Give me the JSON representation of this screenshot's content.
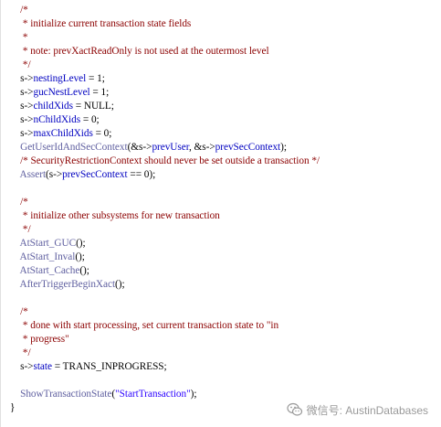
{
  "code_lines": [
    [
      {
        "t": "    /*",
        "c": "cmt"
      }
    ],
    [
      {
        "t": "     * initialize current transaction state fields",
        "c": "cmt"
      }
    ],
    [
      {
        "t": "     *",
        "c": "cmt"
      }
    ],
    [
      {
        "t": "     * note: prevXactReadOnly is not used at the outermost level",
        "c": "cmt"
      }
    ],
    [
      {
        "t": "     */",
        "c": "cmt"
      }
    ],
    [
      {
        "t": "    s->",
        "c": "pl"
      },
      {
        "t": "nestingLevel",
        "c": "fld"
      },
      {
        "t": " = 1;",
        "c": "pl"
      }
    ],
    [
      {
        "t": "    s->",
        "c": "pl"
      },
      {
        "t": "gucNestLevel",
        "c": "fld"
      },
      {
        "t": " = 1;",
        "c": "pl"
      }
    ],
    [
      {
        "t": "    s->",
        "c": "pl"
      },
      {
        "t": "childXids",
        "c": "fld"
      },
      {
        "t": " = NULL;",
        "c": "pl"
      }
    ],
    [
      {
        "t": "    s->",
        "c": "pl"
      },
      {
        "t": "nChildXids",
        "c": "fld"
      },
      {
        "t": " = 0;",
        "c": "pl"
      }
    ],
    [
      {
        "t": "    s->",
        "c": "pl"
      },
      {
        "t": "maxChildXids",
        "c": "fld"
      },
      {
        "t": " = 0;",
        "c": "pl"
      }
    ],
    [
      {
        "t": "    GetUserIdAndSecContext",
        "c": "fn"
      },
      {
        "t": "(&s->",
        "c": "pl"
      },
      {
        "t": "prevUser",
        "c": "fld"
      },
      {
        "t": ", &s->",
        "c": "pl"
      },
      {
        "t": "prevSecContext",
        "c": "fld"
      },
      {
        "t": ");",
        "c": "pl"
      }
    ],
    [
      {
        "t": "    /* SecurityRestrictionContext should never be set outside a transaction */",
        "c": "cmt"
      }
    ],
    [
      {
        "t": "    Assert",
        "c": "fn"
      },
      {
        "t": "(s->",
        "c": "pl"
      },
      {
        "t": "prevSecContext",
        "c": "fld"
      },
      {
        "t": " == 0);",
        "c": "pl"
      }
    ],
    [
      {
        "t": "",
        "c": "pl"
      }
    ],
    [
      {
        "t": "    /*",
        "c": "cmt"
      }
    ],
    [
      {
        "t": "     * initialize other subsystems for new transaction",
        "c": "cmt"
      }
    ],
    [
      {
        "t": "     */",
        "c": "cmt"
      }
    ],
    [
      {
        "t": "    AtStart_GUC",
        "c": "fn"
      },
      {
        "t": "();",
        "c": "pl"
      }
    ],
    [
      {
        "t": "    AtStart_Inval",
        "c": "fn"
      },
      {
        "t": "();",
        "c": "pl"
      }
    ],
    [
      {
        "t": "    AtStart_Cache",
        "c": "fn"
      },
      {
        "t": "();",
        "c": "pl"
      }
    ],
    [
      {
        "t": "    AfterTriggerBeginXact",
        "c": "fn"
      },
      {
        "t": "();",
        "c": "pl"
      }
    ],
    [
      {
        "t": "",
        "c": "pl"
      }
    ],
    [
      {
        "t": "    /*",
        "c": "cmt"
      }
    ],
    [
      {
        "t": "     * done with start processing, set current transaction state to \"in",
        "c": "cmt"
      }
    ],
    [
      {
        "t": "     * progress\"",
        "c": "cmt"
      }
    ],
    [
      {
        "t": "     */",
        "c": "cmt"
      }
    ],
    [
      {
        "t": "    s->",
        "c": "pl"
      },
      {
        "t": "state",
        "c": "fld"
      },
      {
        "t": " = TRANS_INPROGRESS;",
        "c": "pl"
      }
    ],
    [
      {
        "t": "",
        "c": "pl"
      }
    ],
    [
      {
        "t": "    ShowTransactionState",
        "c": "fn"
      },
      {
        "t": "(",
        "c": "pl"
      },
      {
        "t": "\"StartTransaction\"",
        "c": "str"
      },
      {
        "t": ");",
        "c": "pl"
      }
    ],
    [
      {
        "t": "}",
        "c": "pl"
      }
    ]
  ],
  "watermark": {
    "text": "微信号: AustinDatabases",
    "icon": "wechat-icon"
  },
  "colors": {
    "comment": "#8b0000",
    "field": "#0000c0",
    "function": "#6060a0",
    "string": "#2a00ff",
    "plain": "#000000"
  }
}
